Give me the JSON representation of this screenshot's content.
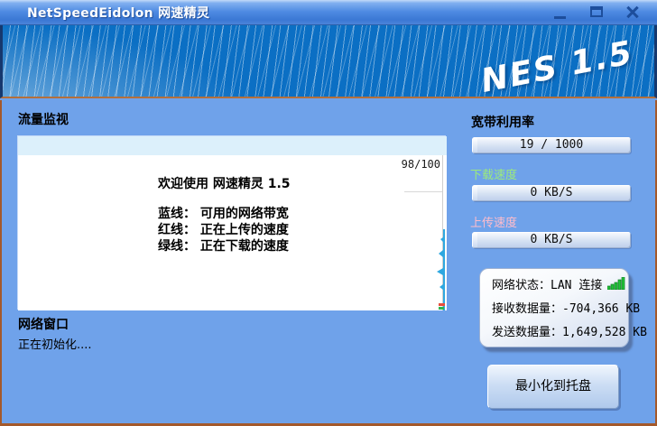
{
  "titlebar": {
    "title": "NetSpeedEidolon 网速精灵",
    "icons": {
      "minimize": "minimize-icon",
      "maximize": "maximize-icon",
      "close": "close-icon"
    }
  },
  "banner": {
    "brand": "NES 1.5"
  },
  "traffic_monitor": {
    "section_title": "流量监视",
    "scale_label": "98/100",
    "welcome_title": "欢迎使用 网速精灵 1.5",
    "legend_lines": [
      "蓝线： 可用的网络带宽",
      "红线：  正在上传的速度",
      "绿线：  正在下载的速度"
    ]
  },
  "network_window": {
    "section_title": "网络窗口",
    "status_text": "正在初始化...."
  },
  "right_panel": {
    "bandwidth": {
      "label": "宽带利用率",
      "value": "19 / 1000"
    },
    "download": {
      "label": "下载速度",
      "value": "0 KB/S"
    },
    "upload": {
      "label": "上传速度",
      "value": "0 KB/S"
    },
    "status_box": {
      "network_label": "网络状态：",
      "network_value": "LAN 连接",
      "signal_icon": "signal-strength-icon",
      "received_label": "接收数据量：",
      "received_value": "-704,366 KB",
      "sent_label": "发送数据量：",
      "sent_value": "1,649,528 KB"
    },
    "tray_button_label": "最小化到托盘"
  },
  "colors": {
    "main_background": "#6FA2EA",
    "frame_border": "#A4592B",
    "banner_blue": "#0B6FC4",
    "download_label": "#9CEB7A",
    "upload_label": "#FFBCCB",
    "graph_bandwidth_line": "#2EA7E0",
    "graph_upload_line": "#E84C3C",
    "graph_download_line": "#2FB44E",
    "signal_green": "#22C43A"
  }
}
